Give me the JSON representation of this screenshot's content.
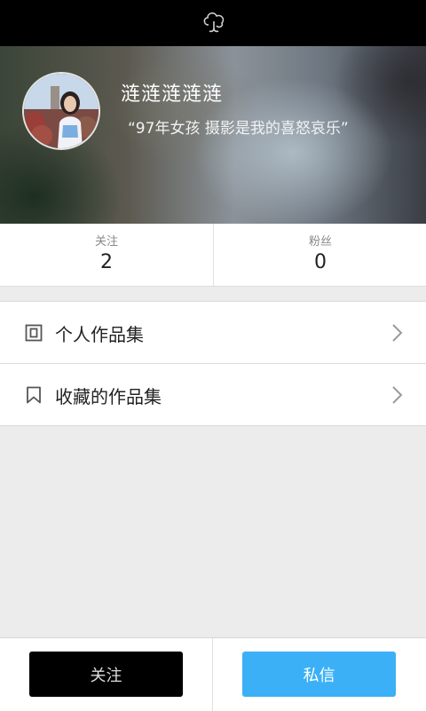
{
  "profile": {
    "name": "涟涟涟涟涟",
    "motto": "“97年女孩 摄影是我的喜怒哀乐”"
  },
  "stats": {
    "following_label": "关注",
    "following_count": "2",
    "followers_label": "粉丝",
    "followers_count": "0"
  },
  "menu": {
    "items": [
      {
        "label": "个人作品集",
        "icon": "album-icon"
      },
      {
        "label": "收藏的作品集",
        "icon": "bookmark-icon"
      }
    ]
  },
  "actions": {
    "follow_label": "关注",
    "message_label": "私信"
  },
  "colors": {
    "topbar": "#000000",
    "message_button": "#3cb0f6",
    "follow_button": "#000000"
  }
}
